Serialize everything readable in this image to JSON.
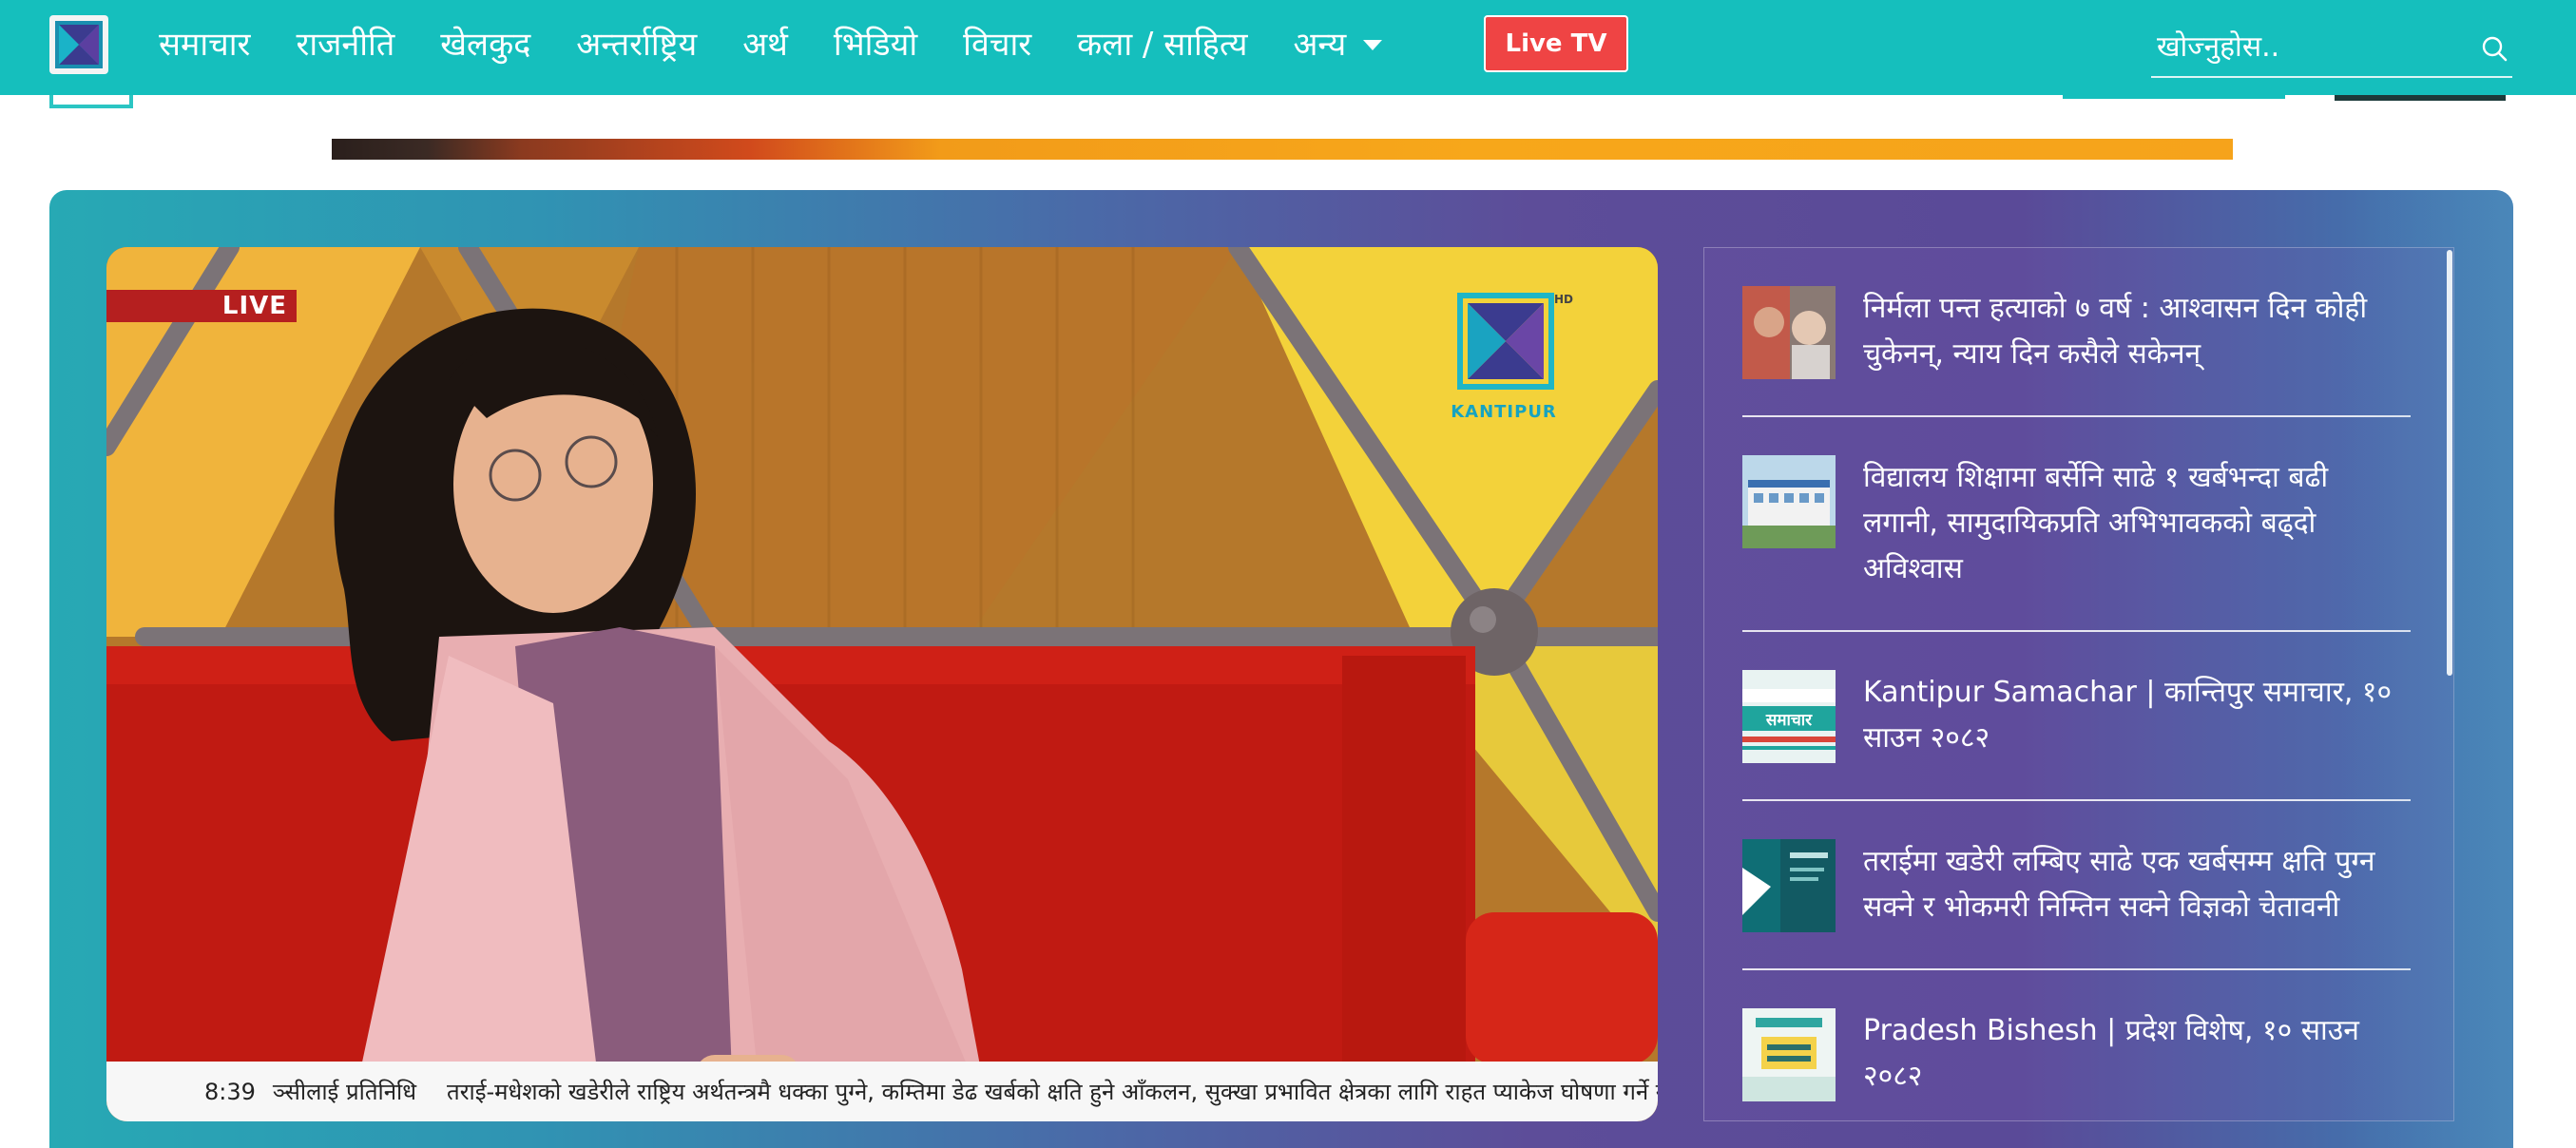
{
  "nav": {
    "items": [
      {
        "label": "समाचार"
      },
      {
        "label": "राजनीति"
      },
      {
        "label": "खेलकुद"
      },
      {
        "label": "अन्तर्राष्ट्रिय"
      },
      {
        "label": "अर्थ"
      },
      {
        "label": "भिडियो"
      },
      {
        "label": "विचार"
      },
      {
        "label": "कला / साहित्य"
      },
      {
        "label": "अन्य"
      }
    ],
    "live_tv": "Live TV",
    "search_placeholder": "खोज्नुहोस.."
  },
  "player": {
    "badge": "LIVE",
    "channel_name": "KANTIPUR",
    "channel_hd": "HD",
    "ticker_time": "8:39",
    "ticker_label": "ञ्सीलाई प्रतिनिधि",
    "ticker_text": "तराई-मधेशको खडेरीले राष्ट्रिय अर्थतन्त्रमै धक्का पुग्ने, कम्तिमा डेढ खर्बको क्षति हुने आँकलन, सुक्खा प्रभावित क्षेत्रका लागि राहत प्याकेज घोषणा गर्ने ग"
  },
  "news": [
    {
      "title": "निर्मला पन्त हत्याको ७ वर्ष : आश्वासन दिन कोही चुकेनन्, न्याय दिन कसैले सकेनन्"
    },
    {
      "title": "विद्यालय शिक्षामा बर्सेनि साढे १ खर्बभन्दा बढी लगानी, सामुदायिकप्रति अभिभावकको बढ्दो अविश्वास"
    },
    {
      "title": "Kantipur Samachar | कान्तिपुर समाचार, १० साउन २०८२",
      "thumb_text": "समाचार"
    },
    {
      "title": "तराईमा खडेरी लम्बिए साढे एक खर्बसम्म क्षति पुग्न सक्ने र भोकमरी निम्तिन सक्ने विज्ञको चेतावनी"
    },
    {
      "title": "Pradesh Bishesh | प्रदेश विशेष, १० साउन २०८२"
    }
  ],
  "colors": {
    "nav_bg": "#15bfbd",
    "live_tv_bg": "#ef4444",
    "live_badge_bg": "#b51f1f"
  }
}
